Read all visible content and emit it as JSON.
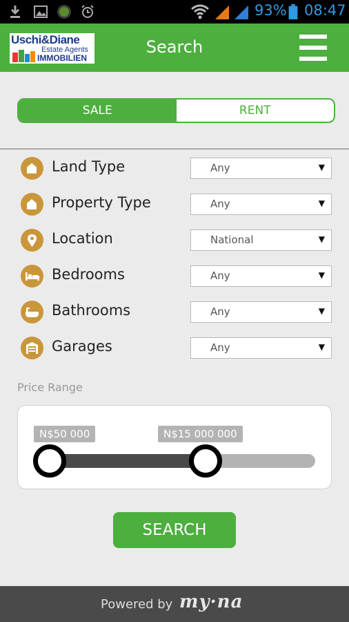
{
  "status_bar": {
    "battery": "93%",
    "time": "08:47",
    "icons": [
      "download-icon",
      "image-icon",
      "app-icon",
      "alarm-icon",
      "wifi-icon",
      "signal-icon",
      "battery-icon"
    ]
  },
  "app_bar": {
    "logo": {
      "line1": "Uschi&Diane",
      "line2": "Estate Agents",
      "line3": "IMMOBILIEN"
    },
    "title": "Search",
    "menu_icon": "hamburger-menu-icon"
  },
  "tabs": {
    "sale": "SALE",
    "rent": "RENT",
    "active": "sale"
  },
  "filters": [
    {
      "label": "Land Type",
      "value": "Any",
      "icon": "land-type-icon"
    },
    {
      "label": "Property Type",
      "value": "Any",
      "icon": "property-type-icon"
    },
    {
      "label": "Location",
      "value": "National",
      "icon": "location-pin-icon"
    },
    {
      "label": "Bedrooms",
      "value": "Any",
      "icon": "bed-icon"
    },
    {
      "label": "Bathrooms",
      "value": "Any",
      "icon": "bathtub-icon"
    },
    {
      "label": "Garages",
      "value": "Any",
      "icon": "garage-icon"
    }
  ],
  "price_range": {
    "label": "Price Range",
    "min_label": "N$50 000",
    "max_label": "N$15 000 000"
  },
  "search_button": "SEARCH",
  "footer": {
    "powered_by": "Powered by",
    "brand": "my·na"
  },
  "colors": {
    "accent": "#4caf3e",
    "icon_bg": "#c9963a",
    "footer_bg": "#4a4a4a"
  }
}
